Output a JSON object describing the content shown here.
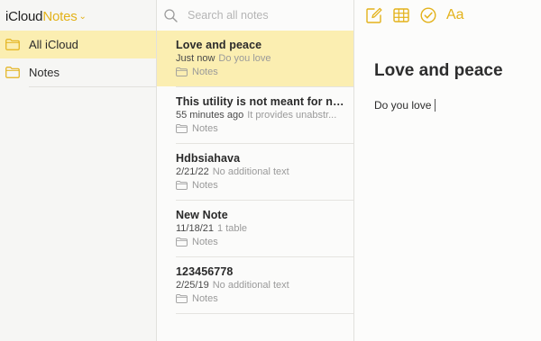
{
  "brand": {
    "service": "iCloud",
    "app": "Notes"
  },
  "folders": [
    {
      "label": "All iCloud",
      "selected": true
    },
    {
      "label": "Notes",
      "selected": false
    }
  ],
  "search": {
    "placeholder": "Search all notes"
  },
  "notes": [
    {
      "title": "Love and peace",
      "date": "Just now",
      "preview": "Do you love",
      "folder": "Notes",
      "selected": true
    },
    {
      "title": "This utility is not meant for no...",
      "date": "55 minutes ago",
      "preview": "It provides unabstr...",
      "folder": "Notes",
      "selected": false
    },
    {
      "title": "Hdbsiahava",
      "date": "2/21/22",
      "preview": "No additional text",
      "folder": "Notes",
      "selected": false
    },
    {
      "title": "New Note",
      "date": "11/18/21",
      "preview": "1 table",
      "folder": "Notes",
      "selected": false
    },
    {
      "title": "123456778",
      "date": "2/25/19",
      "preview": "No additional text",
      "folder": "Notes",
      "selected": false
    }
  ],
  "editor": {
    "title": "Love and peace",
    "body": "Do you love",
    "toolbar": [
      "compose-icon",
      "table-icon",
      "checklist-icon",
      "format-icon"
    ],
    "format_label": "Aa"
  },
  "colors": {
    "accent": "#e3b21a",
    "selection": "#fbeeb1"
  }
}
